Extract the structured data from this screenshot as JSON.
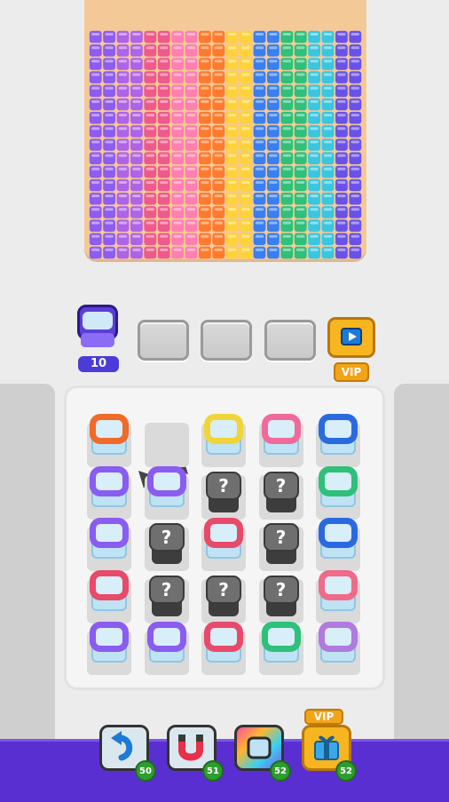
{
  "pixel_wall": {
    "columns": [
      "#8e5cf0",
      "#8e5cf0",
      "#ae64e6",
      "#ae64e6",
      "#ee5a8a",
      "#ee5a8a",
      "#ff7fb0",
      "#ff7fb0",
      "#ff7a2e",
      "#ff7a2e",
      "#ffd23a",
      "#ffd23a",
      "#3a7ff0",
      "#3a7ff0",
      "#2fc07a",
      "#2fc07a",
      "#3ac6e0",
      "#3ac6e0",
      "#6a52e8",
      "#6a52e8"
    ],
    "rows": 17
  },
  "queue": {
    "active_count": "10",
    "active_color": "#7a5cf0",
    "vip_label": "VIP"
  },
  "board": {
    "cells": [
      [
        "pot:#f06a2a",
        "empty",
        "pot:#f0d53a",
        "pot:#f06a9a",
        "pot:#2a6ae0"
      ],
      [
        "pot:#8a5cf0",
        "pot:#8a5cf0",
        "mystery",
        "mystery",
        "pot:#2fc07a"
      ],
      [
        "pot:#8a5cf0",
        "mystery",
        "pot:#e84a6a",
        "mystery",
        "pot:#2a6ae0"
      ],
      [
        "pot:#e84a6a",
        "mystery",
        "mystery",
        "mystery",
        "pot:#f06a8a"
      ],
      [
        "pot:#8a5cf0",
        "pot:#8a5cf0",
        "pot:#e84a6a",
        "pot:#2fc07a",
        "pot:#b07ae0"
      ]
    ],
    "mystery_symbol": "?"
  },
  "boosters": [
    {
      "name": "undo-booster",
      "count": "50"
    },
    {
      "name": "magnet-booster",
      "count": "51"
    },
    {
      "name": "shuffle-booster",
      "count": "52"
    },
    {
      "name": "vip-booster",
      "count": "52",
      "tag": "VIP"
    }
  ]
}
